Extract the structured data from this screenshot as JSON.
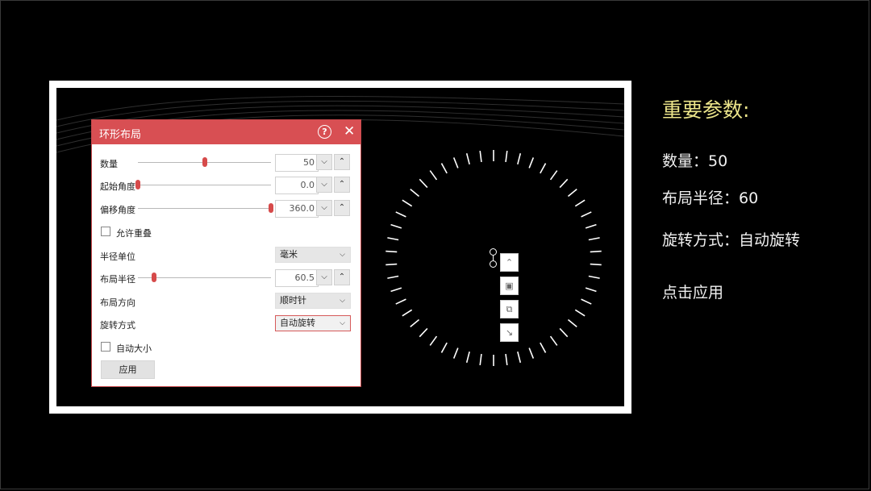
{
  "dialog": {
    "title": "环形布局",
    "help_icon": "?",
    "close_icon": "✕",
    "rows": {
      "quantity": {
        "label": "数量",
        "value": "50",
        "slider_fraction": 0.5
      },
      "start_angle": {
        "label": "起始角度",
        "value": "0.0",
        "slider_fraction": 0.0
      },
      "offset_angle": {
        "label": "偏移角度",
        "value": "360.0",
        "slider_fraction": 1.0
      },
      "allow_overlap": {
        "label": "允许重叠",
        "checked": false
      },
      "radius_unit": {
        "label": "半径单位",
        "value": "毫米"
      },
      "layout_radius": {
        "label": "布局半径",
        "value": "60.5",
        "slider_fraction": 0.12
      },
      "layout_direction": {
        "label": "布局方向",
        "value": "顺时针"
      },
      "rotation_mode": {
        "label": "旋转方式",
        "value": "自动旋转"
      },
      "auto_size": {
        "label": "自动大小",
        "checked": false
      }
    },
    "apply_label": "应用"
  },
  "ring": {
    "tick_count": 50,
    "color": "#ffffff"
  },
  "side_panel": {
    "title": "重要参数:",
    "quantity_line": "数量：50",
    "radius_line": "布局半径：60",
    "rotation_line": "旋转方式：自动旋转",
    "click_apply": "点击应用"
  },
  "colors": {
    "accent": "#d84f53",
    "title_yellow": "#ece58a",
    "background": "#000000"
  }
}
